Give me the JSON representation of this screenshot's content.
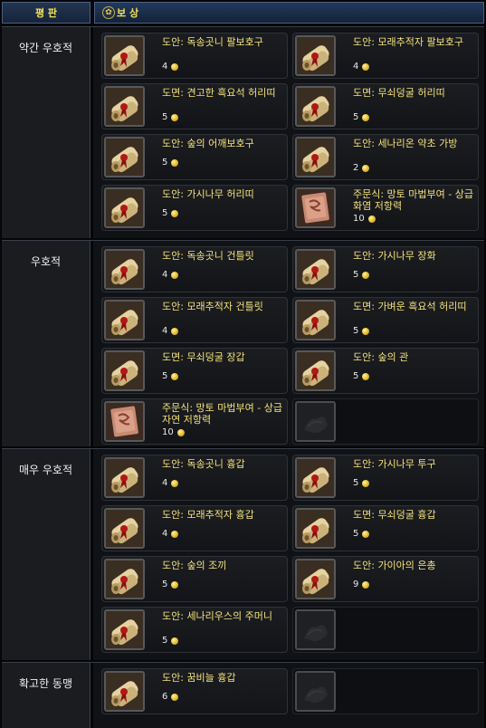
{
  "header": {
    "reputation_label": "평 판",
    "reward_label": "보 상"
  },
  "sections": [
    {
      "label": "약간 우호적",
      "items": [
        {
          "name": "도안: 독송곳니 팔보호구",
          "qty": "4",
          "icon": "blueprint-scroll-icon"
        },
        {
          "name": "도안: 모래추적자 팔보호구",
          "qty": "4",
          "icon": "blueprint-scroll-icon"
        },
        {
          "name": "도면: 견고한 흑요석 허리띠",
          "qty": "5",
          "icon": "blueprint-scroll-icon"
        },
        {
          "name": "도면: 무쇠덩굴 허리띠",
          "qty": "5",
          "icon": "blueprint-scroll-icon"
        },
        {
          "name": "도안: 숲의 어깨보호구",
          "qty": "5",
          "icon": "blueprint-scroll-icon"
        },
        {
          "name": "도안: 세나리온 약초 가방",
          "qty": "2",
          "icon": "blueprint-scroll-icon"
        },
        {
          "name": "도안: 가시나무 허리띠",
          "qty": "5",
          "icon": "blueprint-scroll-icon"
        },
        {
          "name": "주문식: 망토 마법부여 - 상급 화염 저항력",
          "qty": "10",
          "icon": "enchant-formula-icon"
        }
      ]
    },
    {
      "label": "우호적",
      "items": [
        {
          "name": "도안: 독송곳니 건틀릿",
          "qty": "4",
          "icon": "blueprint-scroll-icon"
        },
        {
          "name": "도안: 가시나무 장화",
          "qty": "5",
          "icon": "blueprint-scroll-icon"
        },
        {
          "name": "도안: 모래추적자 건틀릿",
          "qty": "4",
          "icon": "blueprint-scroll-icon"
        },
        {
          "name": "도면: 가벼운 흑요석 허리띠",
          "qty": "5",
          "icon": "blueprint-scroll-icon"
        },
        {
          "name": "도면: 무쇠덩굴 장갑",
          "qty": "5",
          "icon": "blueprint-scroll-icon"
        },
        {
          "name": "도안: 숲의 관",
          "qty": "5",
          "icon": "blueprint-scroll-icon"
        },
        {
          "name": "주문식: 망토 마법부여 - 상급 자연 저항력",
          "qty": "10",
          "icon": "enchant-formula-icon"
        }
      ]
    },
    {
      "label": "매우 우호적",
      "items": [
        {
          "name": "도안: 독송곳니 흉갑",
          "qty": "4",
          "icon": "blueprint-scroll-icon"
        },
        {
          "name": "도안: 가시나무 투구",
          "qty": "5",
          "icon": "blueprint-scroll-icon"
        },
        {
          "name": "도안: 모래추적자 흉갑",
          "qty": "4",
          "icon": "blueprint-scroll-icon"
        },
        {
          "name": "도면: 무쇠덩굴 흉갑",
          "qty": "5",
          "icon": "blueprint-scroll-icon"
        },
        {
          "name": "도안: 숲의 조끼",
          "qty": "5",
          "icon": "blueprint-scroll-icon"
        },
        {
          "name": "도안: 가이아의 은총",
          "qty": "9",
          "icon": "blueprint-scroll-icon"
        },
        {
          "name": "도안: 세나리우스의 주머니",
          "qty": "5",
          "icon": "blueprint-scroll-icon"
        }
      ]
    },
    {
      "label": "확고한 동맹",
      "items": [
        {
          "name": "도안: 꿈비늘 흉갑",
          "qty": "6",
          "icon": "blueprint-scroll-icon"
        }
      ]
    }
  ]
}
